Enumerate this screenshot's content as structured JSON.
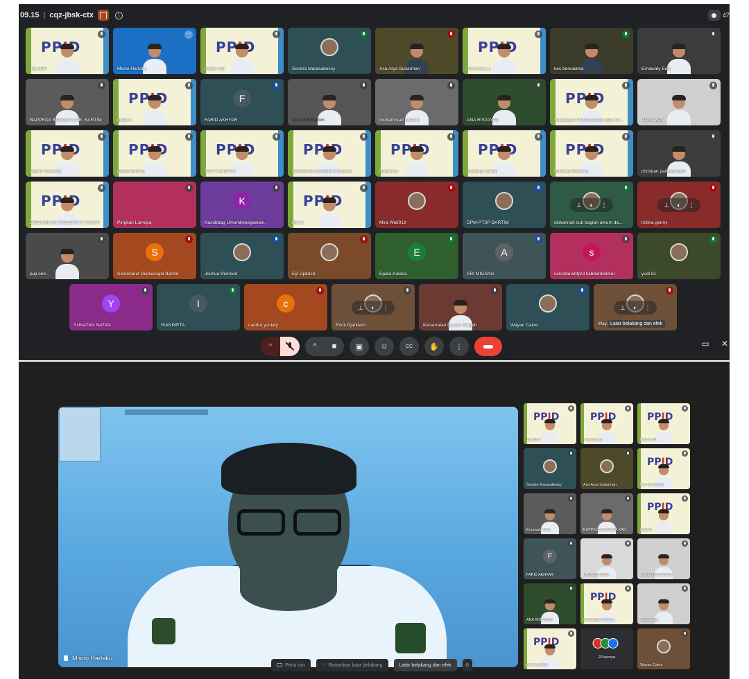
{
  "header": {
    "time": "09.15",
    "meeting_code": "cqz-jbsk-ctx",
    "participant_count": "47"
  },
  "colors": {
    "avatar_pink": "#b3305e",
    "avatar_purple": "#6d3c9c",
    "avatar_teal": "#2e4f56",
    "avatar_orange": "#a4481f",
    "avatar_green": "#2f5e2f",
    "avatar_red": "#8a2b2b",
    "end_call": "#ea4335"
  },
  "grid": {
    "rows": [
      [
        "Jok BBP",
        "Misno Hartaku",
        "Haslin ND",
        "Sendra Marasabessy",
        "Asa Arya Sudarman",
        "Theresia Lu",
        "kec benualima",
        "Ernawaty Erna"
      ],
      [
        "BAPPEDA BANGDA KAB. BARTIM",
        "indah h",
        "FARID AKHYAR",
        "DP3AKB Bartim",
        "muhammad ibrahim",
        "ANA RISTAYATI",
        "Subbagian Perencanaan dan Ke...",
        "Wanrawaty"
      ],
      [
        "Agnes Vanessa",
        "DIMEARIATE",
        "TATY HARIATY",
        "sekretariat disnakertransperin",
        "Eobardus",
        "Dodang Haetal",
        "Endang Wahyuni",
        "christian parlindungan"
      ],
      [
        "DISDAMKAR KAB.BARTO TIMUR",
        "Pingkan Lumopa",
        "Kasubbag Umumkepegawain.",
        "theres",
        "Mira Wati019",
        "DPM-PTSP BARTIM",
        "diskannak sub bagian umum da...",
        "ristina genny"
      ],
      [
        "puji ono",
        "Sekretariat Disdukcapil Bartim",
        "Joshua Rienson",
        "Eyl Djatrich",
        "Epata Kulana",
        "ARI MIGANG",
        "sekretariatdprd kabbaritotimur",
        "yudi 81"
      ],
      [
        "YUNATAN NATAN",
        "ISANINETA",
        "candra yuniaty",
        "Erick Djandam",
        "Kecamatan Dusun Tengah",
        "Wayan Cakre",
        "Wayan"
      ]
    ],
    "letters": {
      "FARID AKHYAR": "F",
      "Kasubbag Umumkepegawain.": "K",
      "Sekretariat Disdukcapil Bartim": "S",
      "Epata Kulana": "E",
      "ARI MIGANG": "A",
      "sekretariatdprd kabbaritotimur": "s",
      "YUNATAN NATAN": "Y",
      "ISANINETA": "I",
      "candra yuniaty": "c"
    },
    "tooltip": "Latar belakang dan efek"
  },
  "toolbar": {
    "labels": {
      "present": "▣",
      "emoji": "☺",
      "captions": "CC",
      "raise": "✋",
      "more": "⋮"
    }
  },
  "spotlight": {
    "name": "Misno Hartaku"
  },
  "thumbs": [
    "Jok BBP",
    "Theresia Lu",
    "Haslin ND",
    "Sendra Marasabessy",
    "Asa Arya Sudarman",
    "kec benualima",
    "Ernawaty Erna",
    "BAPPEDA BANGDA KAB.",
    "indah h",
    "FARID AKHYAR",
    "DP3AKB Bartim",
    "muhammad ibrahim",
    "ANA RISTAYATI",
    "Subbagian Perenc...",
    "Wanrawaty",
    "ristina genny",
    "29 lainnya",
    "Wayan Cakre"
  ],
  "bottom_bar": {
    "needs_permission": "Perlu izin",
    "blur_background": "Buramkan latar belakang",
    "background_effects": "Latar belakang dan efek"
  }
}
